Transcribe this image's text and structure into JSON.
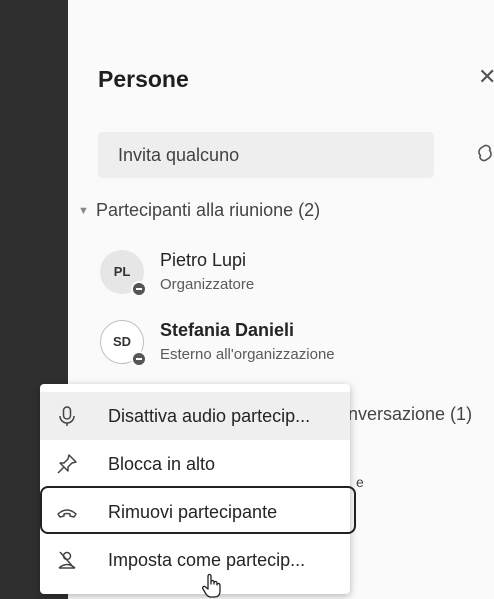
{
  "panel": {
    "title": "Persone",
    "invite_placeholder": "Invita qualcuno",
    "section_label": "Partecipanti alla riunione (2)",
    "participants": [
      {
        "initials": "PL",
        "name": "Pietro Lupi",
        "role": "Organizzatore"
      },
      {
        "initials": "SD",
        "name": "Stefania Danieli",
        "role": "Esterno all'organizzazione"
      }
    ],
    "hidden_section_fragment": "nversazione (1)",
    "hidden_fragment_2": "e"
  },
  "context_menu": {
    "items": [
      {
        "label": "Disattiva audio partecip...",
        "icon": "microphone-icon"
      },
      {
        "label": "Blocca in alto",
        "icon": "pin-icon"
      },
      {
        "label": "Rimuovi partecipante",
        "icon": "hang-up-icon"
      },
      {
        "label": "Imposta come partecip...",
        "icon": "attendee-icon"
      }
    ]
  },
  "colors": {
    "rail": "#2f2f2f",
    "panel": "#fafafa",
    "hover": "#efefef"
  }
}
